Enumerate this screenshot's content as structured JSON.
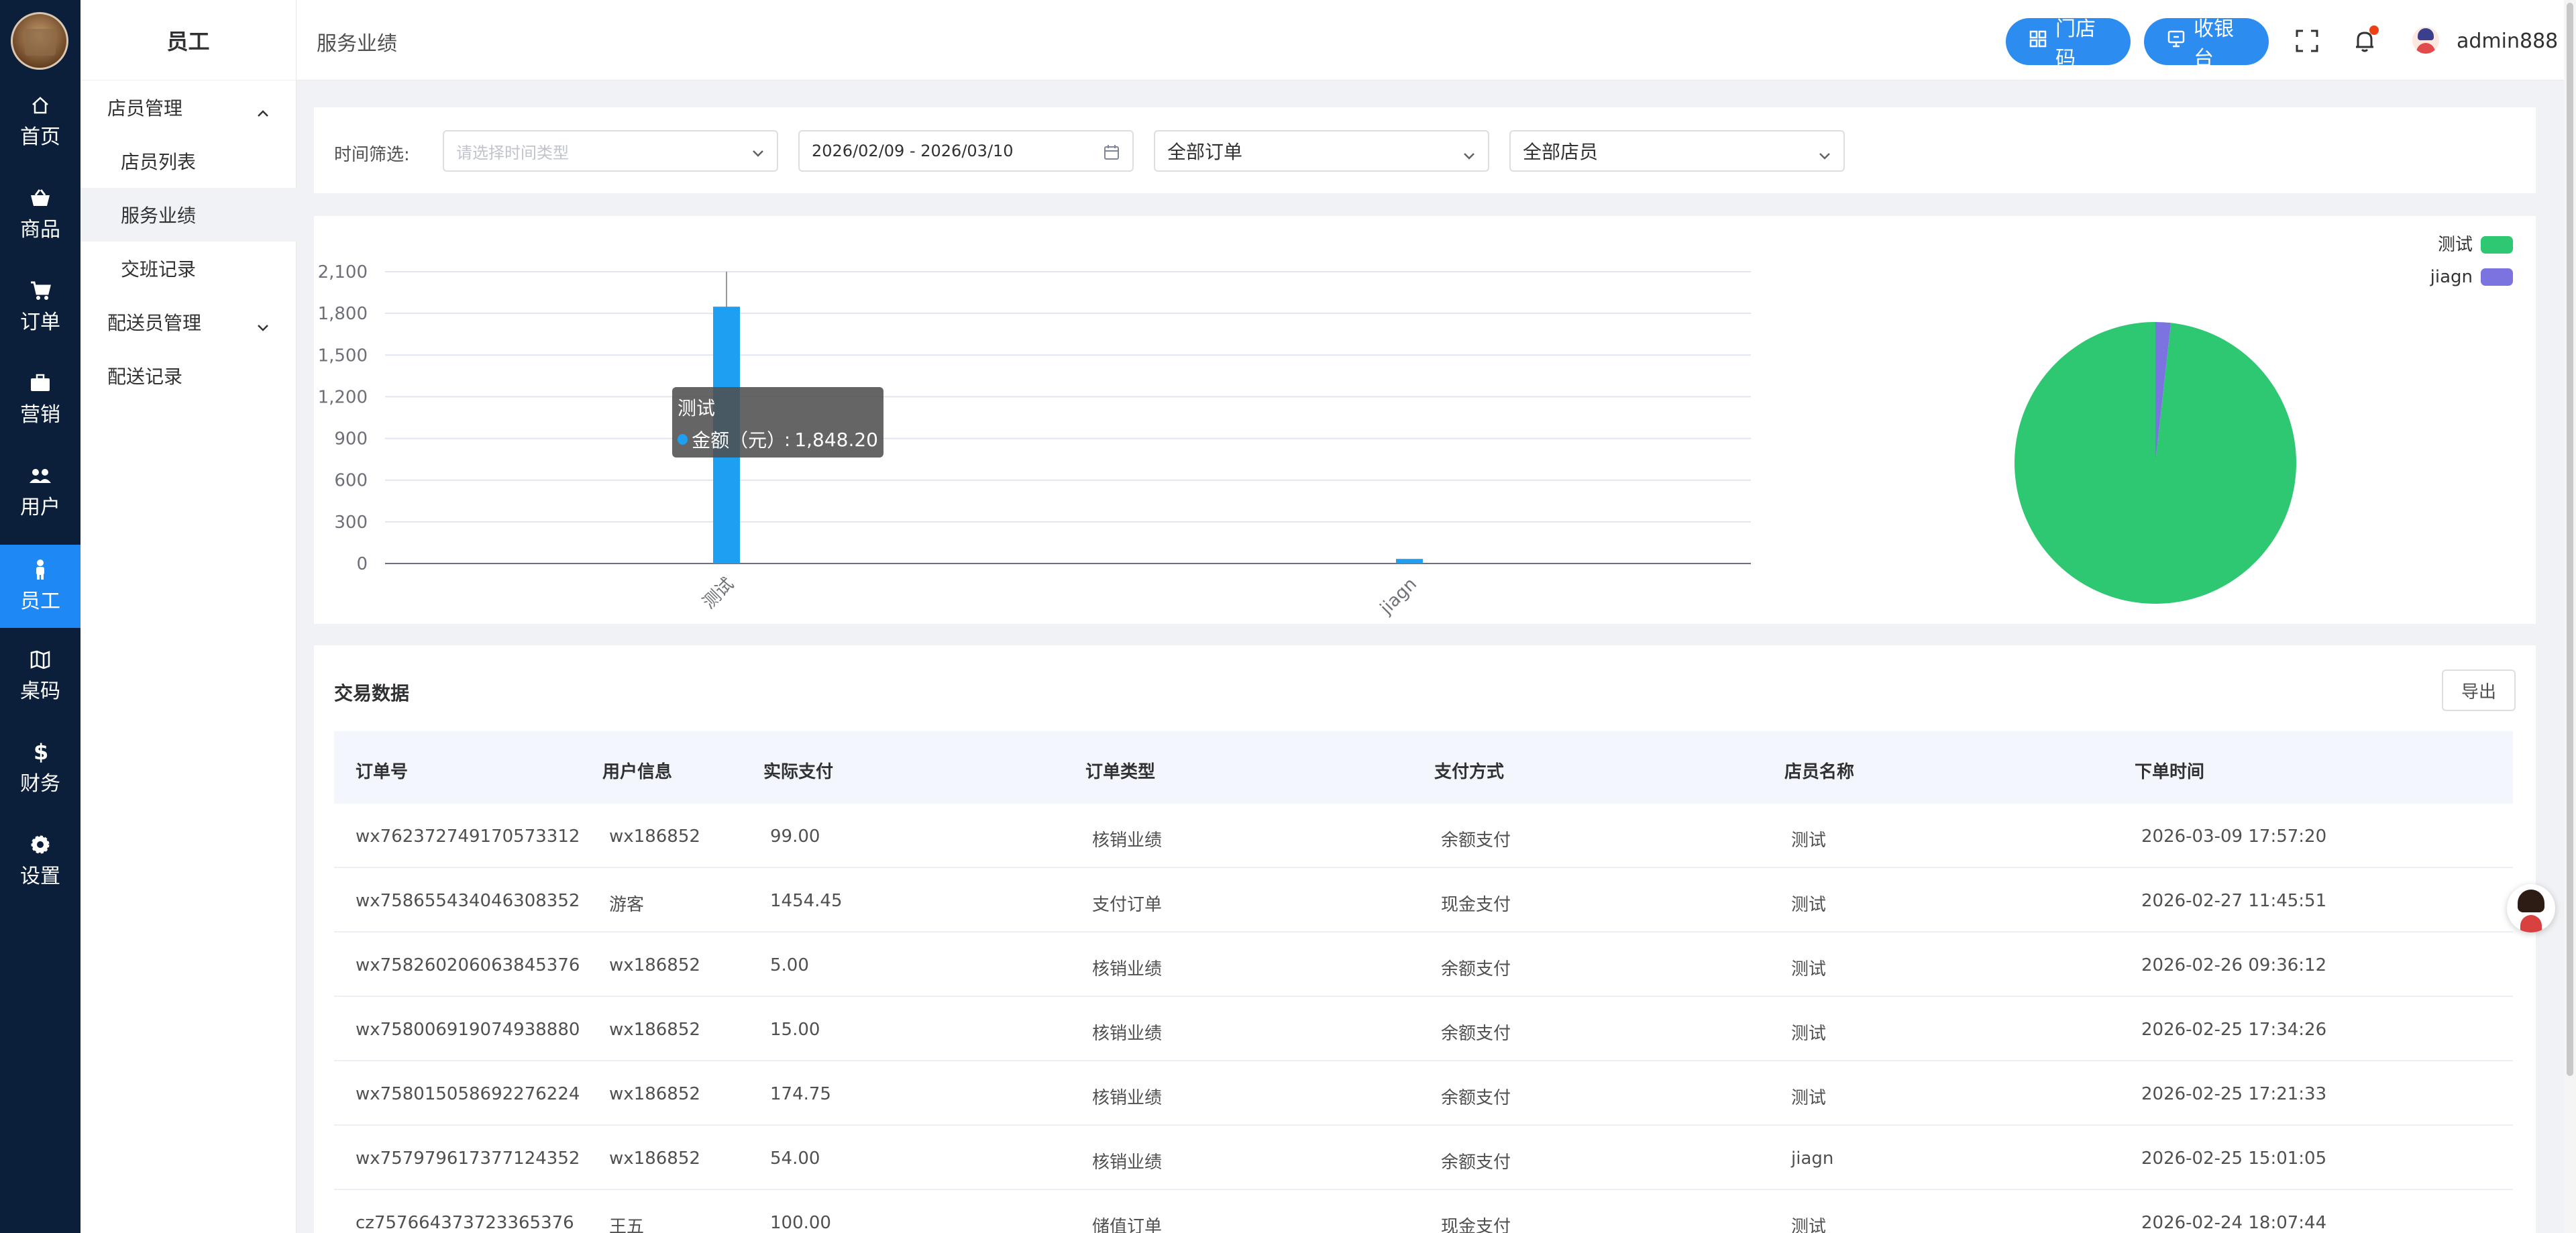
{
  "rail": {
    "items": [
      {
        "label": "首页",
        "icon": "home-icon"
      },
      {
        "label": "商品",
        "icon": "basket-icon"
      },
      {
        "label": "订单",
        "icon": "cart-icon"
      },
      {
        "label": "营销",
        "icon": "briefcase-icon"
      },
      {
        "label": "用户",
        "icon": "users-icon"
      },
      {
        "label": "员工",
        "icon": "staff-icon",
        "active": true
      },
      {
        "label": "桌码",
        "icon": "map-icon"
      },
      {
        "label": "财务",
        "icon": "dollar-icon"
      },
      {
        "label": "设置",
        "icon": "gear-icon"
      }
    ]
  },
  "submenu": {
    "title": "员工",
    "groups": [
      {
        "label": "店员管理",
        "expanded": true
      },
      {
        "label": "配送员管理",
        "expanded": false
      }
    ],
    "items": [
      "店员列表",
      "服务业绩",
      "交班记录",
      "配送记录"
    ],
    "active_item": "服务业绩"
  },
  "header": {
    "breadcrumb": "服务业绩",
    "store_code_btn": "门店码",
    "cashier_btn": "收银台",
    "username": "admin888"
  },
  "filters": {
    "label": "时间筛选:",
    "time_type_placeholder": "请选择时间类型",
    "date_range": "2026/02/09 - 2026/03/10",
    "order_type": "全部订单",
    "staff": "全部店员"
  },
  "chart_data": [
    {
      "type": "bar",
      "categories": [
        "测试",
        "jiagn"
      ],
      "series": [
        {
          "name": "金额（元）",
          "values": [
            1848.2,
            33
          ]
        }
      ],
      "ylim": [
        0,
        2100
      ],
      "yticks": [
        "0",
        "300",
        "600",
        "900",
        "1,200",
        "1,500",
        "1,800",
        "2,100"
      ],
      "color": "#1e9ff2",
      "tooltip": {
        "title": "测试",
        "label": "金额（元）",
        "value": "1,848.20"
      }
    },
    {
      "type": "pie",
      "labels": [
        "测试",
        "jiagn"
      ],
      "values": [
        1848.2,
        33
      ],
      "colors": [
        "#2ec872",
        "#7b74e0"
      ],
      "legend": "top-right"
    }
  ],
  "table": {
    "title": "交易数据",
    "export_btn": "导出",
    "columns": [
      "订单号",
      "用户信息",
      "实际支付",
      "订单类型",
      "支付方式",
      "店员名称",
      "下单时间"
    ],
    "rows": [
      [
        "wx762372749170573312",
        "wx186852",
        "99.00",
        "核销业绩",
        "余额支付",
        "测试",
        "2026-03-09 17:57:20"
      ],
      [
        "wx758655434046308352",
        "游客",
        "1454.45",
        "支付订单",
        "现金支付",
        "测试",
        "2026-02-27 11:45:51"
      ],
      [
        "wx758260206063845376",
        "wx186852",
        "5.00",
        "核销业绩",
        "余额支付",
        "测试",
        "2026-02-26 09:36:12"
      ],
      [
        "wx758006919074938880",
        "wx186852",
        "15.00",
        "核销业绩",
        "余额支付",
        "测试",
        "2026-02-25 17:34:26"
      ],
      [
        "wx758015058692276224",
        "wx186852",
        "174.75",
        "核销业绩",
        "余额支付",
        "测试",
        "2026-02-25 17:21:33"
      ],
      [
        "wx757979617377124352",
        "wx186852",
        "54.00",
        "核销业绩",
        "余额支付",
        "jiagn",
        "2026-02-25 15:01:05"
      ],
      [
        "cz757664373723365376",
        "王五",
        "100.00",
        "储值订单",
        "现金支付",
        "测试",
        "2026-02-24 18:07:44"
      ]
    ]
  }
}
